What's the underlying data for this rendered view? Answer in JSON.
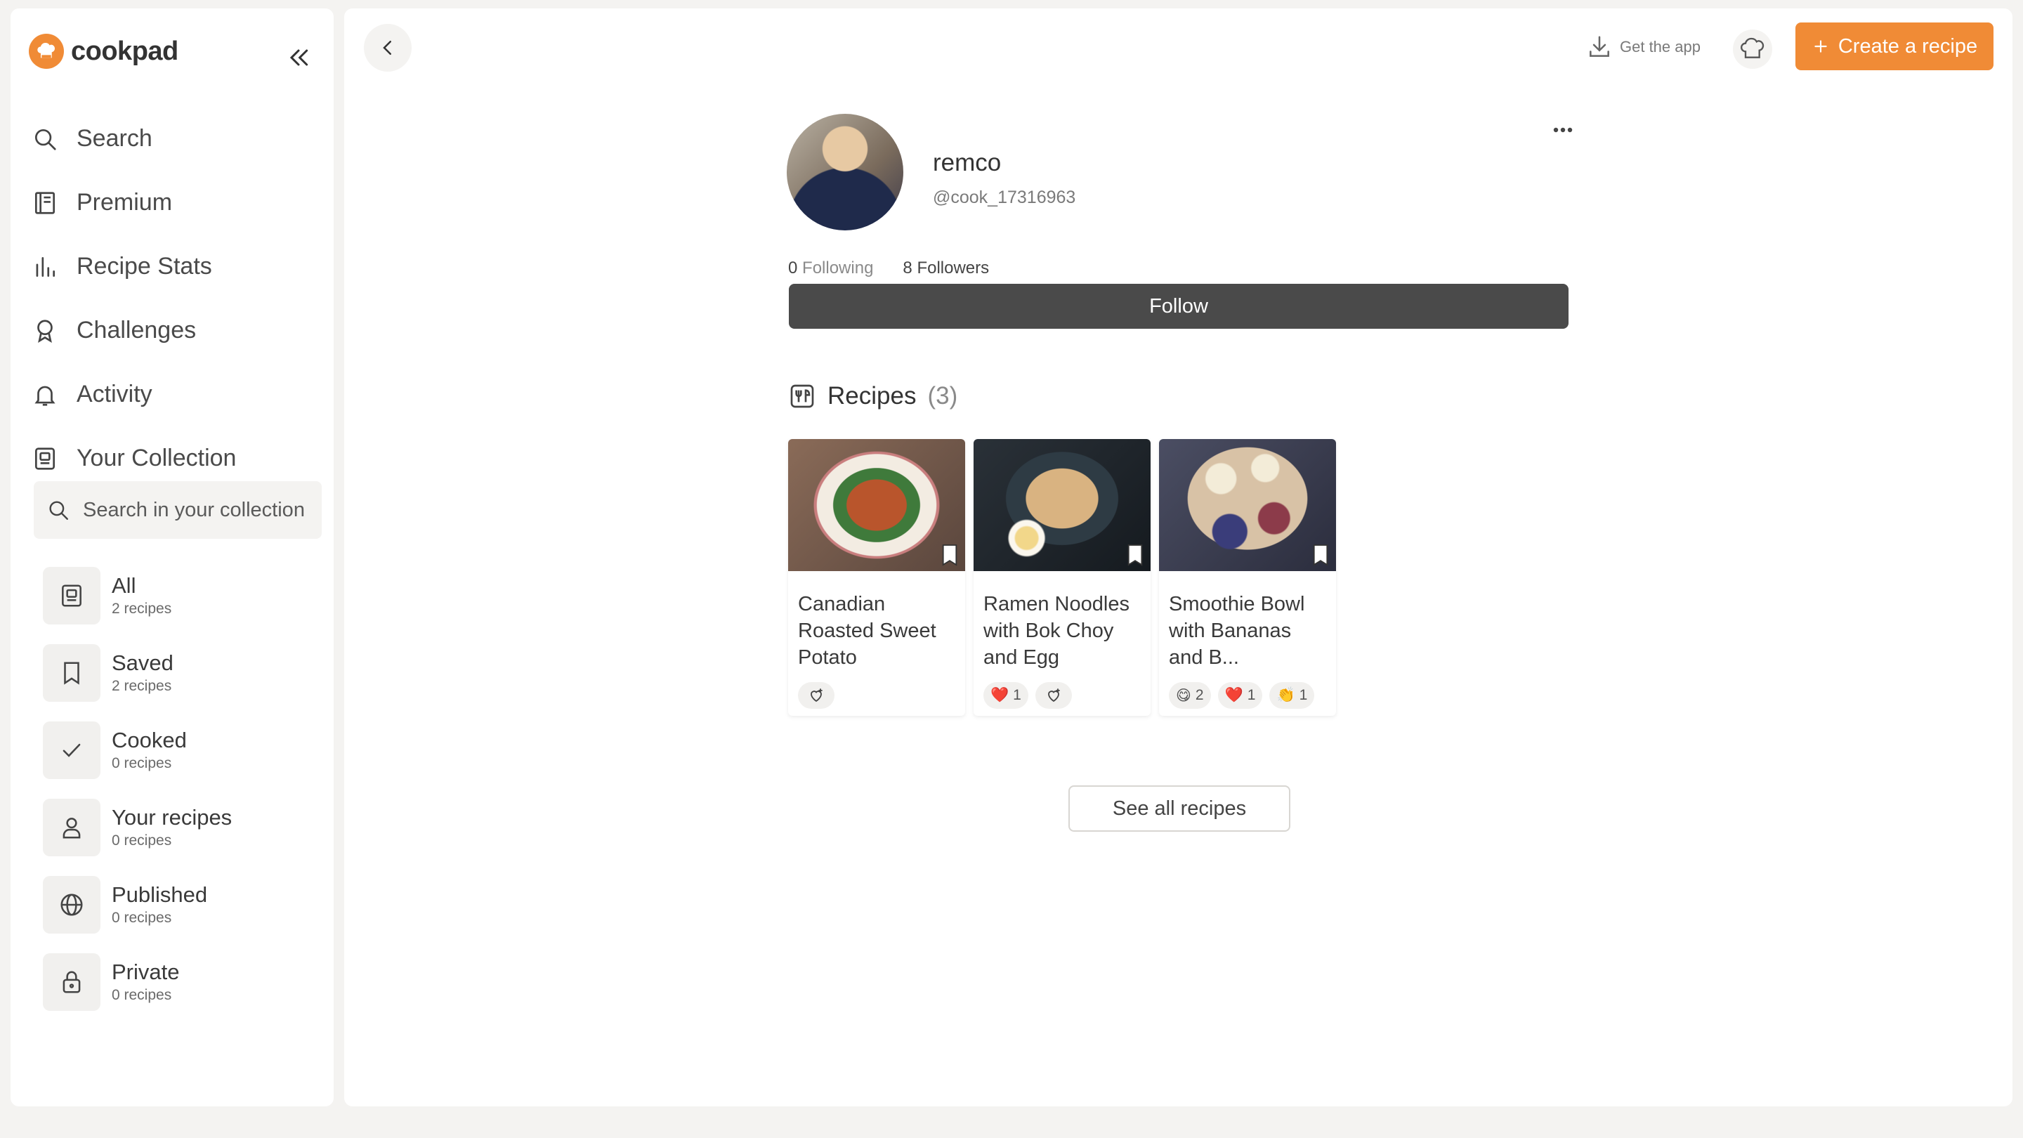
{
  "brand": {
    "name": "cookpad"
  },
  "nav": [
    {
      "label": "Search",
      "icon": "search-icon"
    },
    {
      "label": "Premium",
      "icon": "premium-icon"
    },
    {
      "label": "Recipe Stats",
      "icon": "stats-icon"
    },
    {
      "label": "Challenges",
      "icon": "award-icon"
    },
    {
      "label": "Activity",
      "icon": "bell-icon"
    },
    {
      "label": "Your Collection",
      "icon": "collection-icon"
    }
  ],
  "collection_search": {
    "placeholder": "Search in your collection"
  },
  "collections": [
    {
      "title": "All",
      "count": "2 recipes",
      "icon": "collection-icon"
    },
    {
      "title": "Saved",
      "count": "2 recipes",
      "icon": "bookmark-icon"
    },
    {
      "title": "Cooked",
      "count": "0 recipes",
      "icon": "check-icon"
    },
    {
      "title": "Your recipes",
      "count": "0 recipes",
      "icon": "user-icon"
    },
    {
      "title": "Published",
      "count": "0 recipes",
      "icon": "globe-icon"
    },
    {
      "title": "Private",
      "count": "0 recipes",
      "icon": "lock-icon"
    }
  ],
  "header": {
    "get_app": "Get the app",
    "create_label": "Create a recipe",
    "accent": "#f08b36"
  },
  "profile": {
    "name": "remco",
    "handle": "@cook_17316963",
    "following_count": "0",
    "following_label": "Following",
    "followers_count": "8",
    "followers_label": "Followers",
    "follow_label": "Follow"
  },
  "recipes": {
    "heading": "Recipes",
    "count": "(3)",
    "see_all": "See all recipes",
    "items": [
      {
        "title": "Canadian Roasted Sweet Potato",
        "reactions": []
      },
      {
        "title": "Ramen Noodles with Bok Choy and Egg",
        "reactions": [
          {
            "emoji": "❤️",
            "count": "1"
          }
        ]
      },
      {
        "title": "Smoothie Bowl with Bananas and B...",
        "reactions": [
          {
            "emoji": "😋",
            "count": "2"
          },
          {
            "emoji": "❤️",
            "count": "1"
          },
          {
            "emoji": "👏",
            "count": "1"
          }
        ]
      }
    ]
  }
}
